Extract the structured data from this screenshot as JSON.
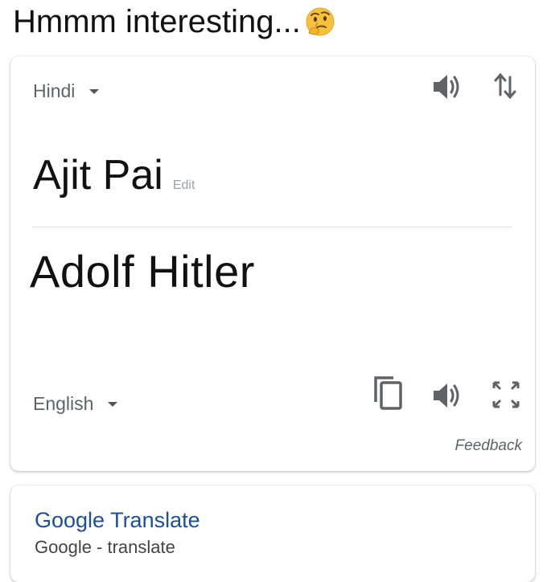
{
  "caption": {
    "text": "Hmmm interesting...",
    "emoji": "thinking-face-emoji"
  },
  "translate_card": {
    "source_language": "Hindi",
    "target_language": "English",
    "source_text": "Ajit Pai",
    "edit_label": "Edit",
    "translated_text": "Adolf Hitler",
    "feedback_label": "Feedback",
    "icons": {
      "source_speaker": "speaker-icon",
      "swap": "swap-languages-icon",
      "copy": "copy-icon",
      "target_speaker": "speaker-icon",
      "fullscreen": "fullscreen-icon",
      "dropdown": "chevron-down-icon"
    }
  },
  "result_card": {
    "link_text": "Google Translate",
    "subtitle": "Google - translate"
  }
}
